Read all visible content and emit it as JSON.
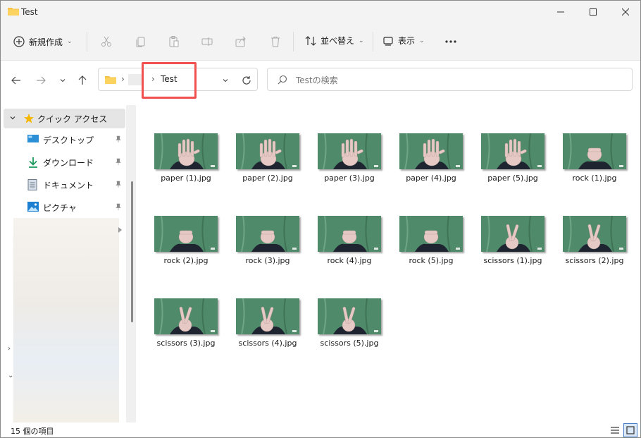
{
  "window": {
    "title": "Test"
  },
  "toolbar": {
    "new_label": "新規作成",
    "sort_label": "並べ替え",
    "view_label": "表示",
    "icons": [
      "cut-icon",
      "copy-icon",
      "paste-icon",
      "rename-icon",
      "share-icon",
      "delete-icon"
    ]
  },
  "address": {
    "crumb": "Test"
  },
  "search": {
    "placeholder": "Testの検索"
  },
  "sidebar": {
    "quick_access": "クイック アクセス",
    "items": [
      {
        "label": "デスクトップ",
        "icon": "desktop-icon"
      },
      {
        "label": "ダウンロード",
        "icon": "download-icon"
      },
      {
        "label": "ドキュメント",
        "icon": "document-icon"
      },
      {
        "label": "ピクチャ",
        "icon": "pictures-icon"
      }
    ]
  },
  "files": [
    {
      "name": "paper (1).jpg",
      "gesture": "paper"
    },
    {
      "name": "paper (2).jpg",
      "gesture": "paper"
    },
    {
      "name": "paper (3).jpg",
      "gesture": "paper"
    },
    {
      "name": "paper (4).jpg",
      "gesture": "paper"
    },
    {
      "name": "paper (5).jpg",
      "gesture": "paper"
    },
    {
      "name": "rock (1).jpg",
      "gesture": "rock"
    },
    {
      "name": "rock (2).jpg",
      "gesture": "rock"
    },
    {
      "name": "rock (3).jpg",
      "gesture": "rock"
    },
    {
      "name": "rock (4).jpg",
      "gesture": "rock"
    },
    {
      "name": "rock (5).jpg",
      "gesture": "rock"
    },
    {
      "name": "scissors (1).jpg",
      "gesture": "scissors"
    },
    {
      "name": "scissors (2).jpg",
      "gesture": "scissors"
    },
    {
      "name": "scissors (3).jpg",
      "gesture": "scissors"
    },
    {
      "name": "scissors (4).jpg",
      "gesture": "scissors"
    },
    {
      "name": "scissors (5).jpg",
      "gesture": "scissors"
    }
  ],
  "status": {
    "item_count": "15 個の項目"
  },
  "colors": {
    "accent": "#f05050",
    "thumb_bg": "#4f8a6a",
    "folder": "#f7c24a"
  }
}
